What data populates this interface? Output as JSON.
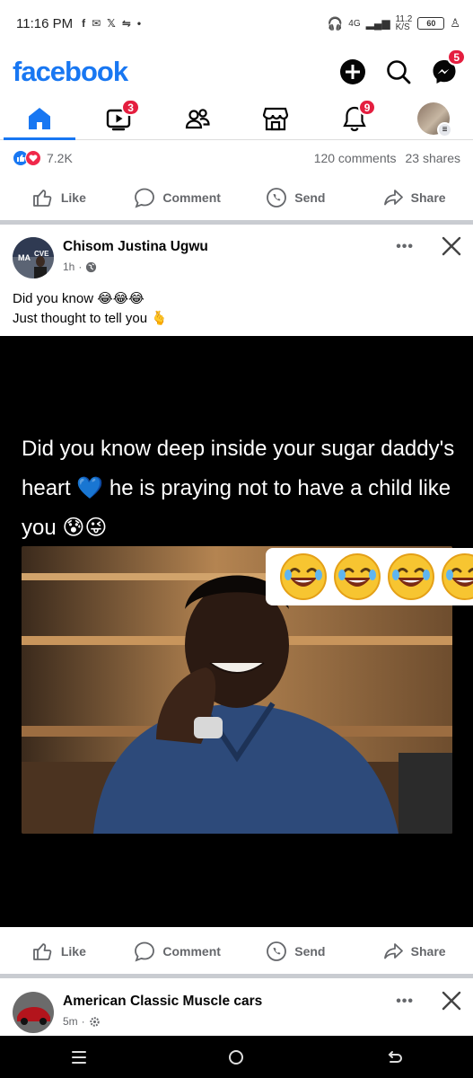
{
  "status_bar": {
    "time": "11:16 PM",
    "network": "4G",
    "speed": "11.2",
    "speed_unit": "K/S",
    "battery": "60"
  },
  "header": {
    "logo": "facebook",
    "messenger_badge": "5"
  },
  "nav": {
    "video_badge": "3",
    "notifications_badge": "9"
  },
  "prev_post": {
    "reactions_count": "7.2K",
    "comments": "120 comments",
    "shares": "23 shares"
  },
  "actions": {
    "like": "Like",
    "comment": "Comment",
    "send": "Send",
    "share": "Share"
  },
  "post": {
    "author": "Chisom Justina Ugwu",
    "time": "1h",
    "line1": "Did you know 😂😂😂",
    "line2": "Just thought to tell you 🫰",
    "caption": "Did you know deep inside your sugar daddy's heart 💙 he is praying not to have a child like you 😰😜"
  },
  "next_post": {
    "author": "American Classic Muscle cars",
    "time": "5m"
  },
  "colors": {
    "brand": "#1877f2",
    "badge": "#e41e3f"
  }
}
